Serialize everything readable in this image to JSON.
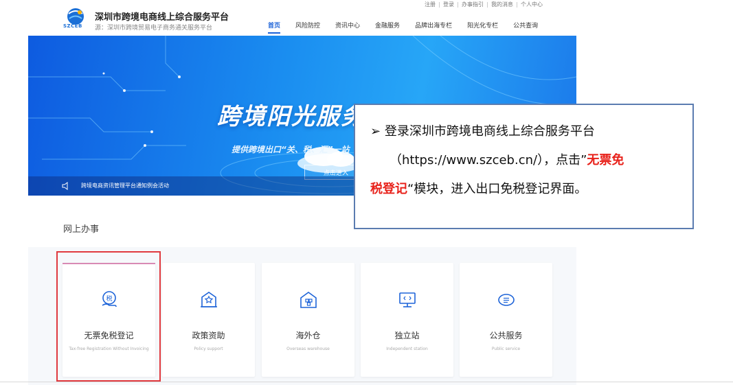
{
  "header": {
    "logo_text": "SZCEB",
    "title": "深圳市跨境电商线上综合服务平台",
    "subtitle": "源：深圳市跨境贸易电子商务通关服务平台",
    "util_links": [
      "注册",
      "登录",
      "办事指引",
      "我的消息",
      "个人中心"
    ],
    "nav": [
      "首页",
      "风险防控",
      "资讯中心",
      "金融服务",
      "品牌出海专栏",
      "阳光化专栏",
      "公共查询"
    ],
    "active_nav": "首页"
  },
  "banner": {
    "title": "跨境阳光服务平台",
    "subtitle": "提供跨境出口“关、税、汇”一站",
    "button": "点击进入",
    "notice": "跨境电商资讯管理平台通知例会活动"
  },
  "section": {
    "title": "网上办事"
  },
  "cards": [
    {
      "label": "无票免税登记",
      "en": "Tax-free Registration Without Invoicing",
      "icon": "tax-hand-icon"
    },
    {
      "label": "政策资助",
      "en": "Policy support",
      "icon": "building-star-icon"
    },
    {
      "label": "海外仓",
      "en": "Overseas warehouse",
      "icon": "warehouse-icon"
    },
    {
      "label": "独立站",
      "en": "Independent station",
      "icon": "monitor-code-icon"
    },
    {
      "label": "公共服务",
      "en": "Public service",
      "icon": "chat-list-icon"
    }
  ],
  "callout": {
    "bullet": "➢",
    "line1": "登录深圳市跨境电商线上综合服务平台",
    "line2_prefix": "（https://www.szceb.cn/），点击”",
    "line2_red": "无票免",
    "line3_red": "税登记",
    "line3_suffix": "“模块，进入出口免税登记界面。"
  },
  "colors": {
    "accent": "#1d63d8",
    "highlight": "#e0393e",
    "callout_red": "#e8221b"
  }
}
